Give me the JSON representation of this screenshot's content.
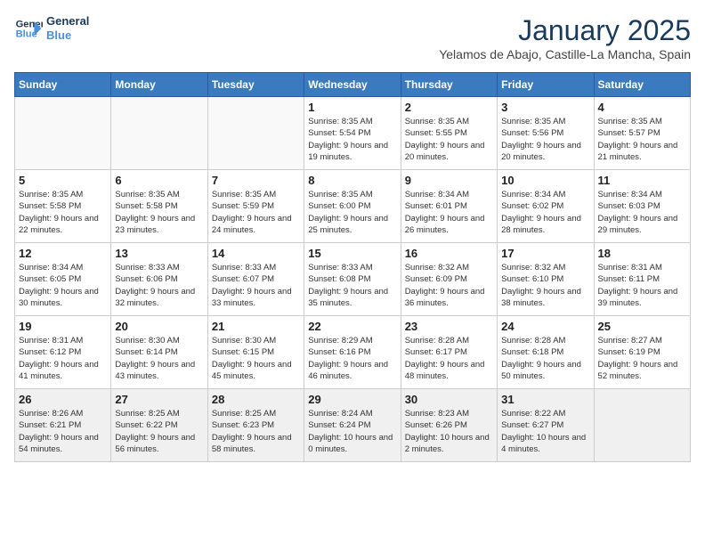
{
  "header": {
    "logo_line1": "General",
    "logo_line2": "Blue",
    "month": "January 2025",
    "location": "Yelamos de Abajo, Castille-La Mancha, Spain"
  },
  "days_of_week": [
    "Sunday",
    "Monday",
    "Tuesday",
    "Wednesday",
    "Thursday",
    "Friday",
    "Saturday"
  ],
  "weeks": [
    [
      {
        "day": "",
        "info": ""
      },
      {
        "day": "",
        "info": ""
      },
      {
        "day": "",
        "info": ""
      },
      {
        "day": "1",
        "info": "Sunrise: 8:35 AM\nSunset: 5:54 PM\nDaylight: 9 hours\nand 19 minutes."
      },
      {
        "day": "2",
        "info": "Sunrise: 8:35 AM\nSunset: 5:55 PM\nDaylight: 9 hours\nand 20 minutes."
      },
      {
        "day": "3",
        "info": "Sunrise: 8:35 AM\nSunset: 5:56 PM\nDaylight: 9 hours\nand 20 minutes."
      },
      {
        "day": "4",
        "info": "Sunrise: 8:35 AM\nSunset: 5:57 PM\nDaylight: 9 hours\nand 21 minutes."
      }
    ],
    [
      {
        "day": "5",
        "info": "Sunrise: 8:35 AM\nSunset: 5:58 PM\nDaylight: 9 hours\nand 22 minutes."
      },
      {
        "day": "6",
        "info": "Sunrise: 8:35 AM\nSunset: 5:58 PM\nDaylight: 9 hours\nand 23 minutes."
      },
      {
        "day": "7",
        "info": "Sunrise: 8:35 AM\nSunset: 5:59 PM\nDaylight: 9 hours\nand 24 minutes."
      },
      {
        "day": "8",
        "info": "Sunrise: 8:35 AM\nSunset: 6:00 PM\nDaylight: 9 hours\nand 25 minutes."
      },
      {
        "day": "9",
        "info": "Sunrise: 8:34 AM\nSunset: 6:01 PM\nDaylight: 9 hours\nand 26 minutes."
      },
      {
        "day": "10",
        "info": "Sunrise: 8:34 AM\nSunset: 6:02 PM\nDaylight: 9 hours\nand 28 minutes."
      },
      {
        "day": "11",
        "info": "Sunrise: 8:34 AM\nSunset: 6:03 PM\nDaylight: 9 hours\nand 29 minutes."
      }
    ],
    [
      {
        "day": "12",
        "info": "Sunrise: 8:34 AM\nSunset: 6:05 PM\nDaylight: 9 hours\nand 30 minutes."
      },
      {
        "day": "13",
        "info": "Sunrise: 8:33 AM\nSunset: 6:06 PM\nDaylight: 9 hours\nand 32 minutes."
      },
      {
        "day": "14",
        "info": "Sunrise: 8:33 AM\nSunset: 6:07 PM\nDaylight: 9 hours\nand 33 minutes."
      },
      {
        "day": "15",
        "info": "Sunrise: 8:33 AM\nSunset: 6:08 PM\nDaylight: 9 hours\nand 35 minutes."
      },
      {
        "day": "16",
        "info": "Sunrise: 8:32 AM\nSunset: 6:09 PM\nDaylight: 9 hours\nand 36 minutes."
      },
      {
        "day": "17",
        "info": "Sunrise: 8:32 AM\nSunset: 6:10 PM\nDaylight: 9 hours\nand 38 minutes."
      },
      {
        "day": "18",
        "info": "Sunrise: 8:31 AM\nSunset: 6:11 PM\nDaylight: 9 hours\nand 39 minutes."
      }
    ],
    [
      {
        "day": "19",
        "info": "Sunrise: 8:31 AM\nSunset: 6:12 PM\nDaylight: 9 hours\nand 41 minutes."
      },
      {
        "day": "20",
        "info": "Sunrise: 8:30 AM\nSunset: 6:14 PM\nDaylight: 9 hours\nand 43 minutes."
      },
      {
        "day": "21",
        "info": "Sunrise: 8:30 AM\nSunset: 6:15 PM\nDaylight: 9 hours\nand 45 minutes."
      },
      {
        "day": "22",
        "info": "Sunrise: 8:29 AM\nSunset: 6:16 PM\nDaylight: 9 hours\nand 46 minutes."
      },
      {
        "day": "23",
        "info": "Sunrise: 8:28 AM\nSunset: 6:17 PM\nDaylight: 9 hours\nand 48 minutes."
      },
      {
        "day": "24",
        "info": "Sunrise: 8:28 AM\nSunset: 6:18 PM\nDaylight: 9 hours\nand 50 minutes."
      },
      {
        "day": "25",
        "info": "Sunrise: 8:27 AM\nSunset: 6:19 PM\nDaylight: 9 hours\nand 52 minutes."
      }
    ],
    [
      {
        "day": "26",
        "info": "Sunrise: 8:26 AM\nSunset: 6:21 PM\nDaylight: 9 hours\nand 54 minutes."
      },
      {
        "day": "27",
        "info": "Sunrise: 8:25 AM\nSunset: 6:22 PM\nDaylight: 9 hours\nand 56 minutes."
      },
      {
        "day": "28",
        "info": "Sunrise: 8:25 AM\nSunset: 6:23 PM\nDaylight: 9 hours\nand 58 minutes."
      },
      {
        "day": "29",
        "info": "Sunrise: 8:24 AM\nSunset: 6:24 PM\nDaylight: 10 hours\nand 0 minutes."
      },
      {
        "day": "30",
        "info": "Sunrise: 8:23 AM\nSunset: 6:26 PM\nDaylight: 10 hours\nand 2 minutes."
      },
      {
        "day": "31",
        "info": "Sunrise: 8:22 AM\nSunset: 6:27 PM\nDaylight: 10 hours\nand 4 minutes."
      },
      {
        "day": "",
        "info": ""
      }
    ]
  ]
}
